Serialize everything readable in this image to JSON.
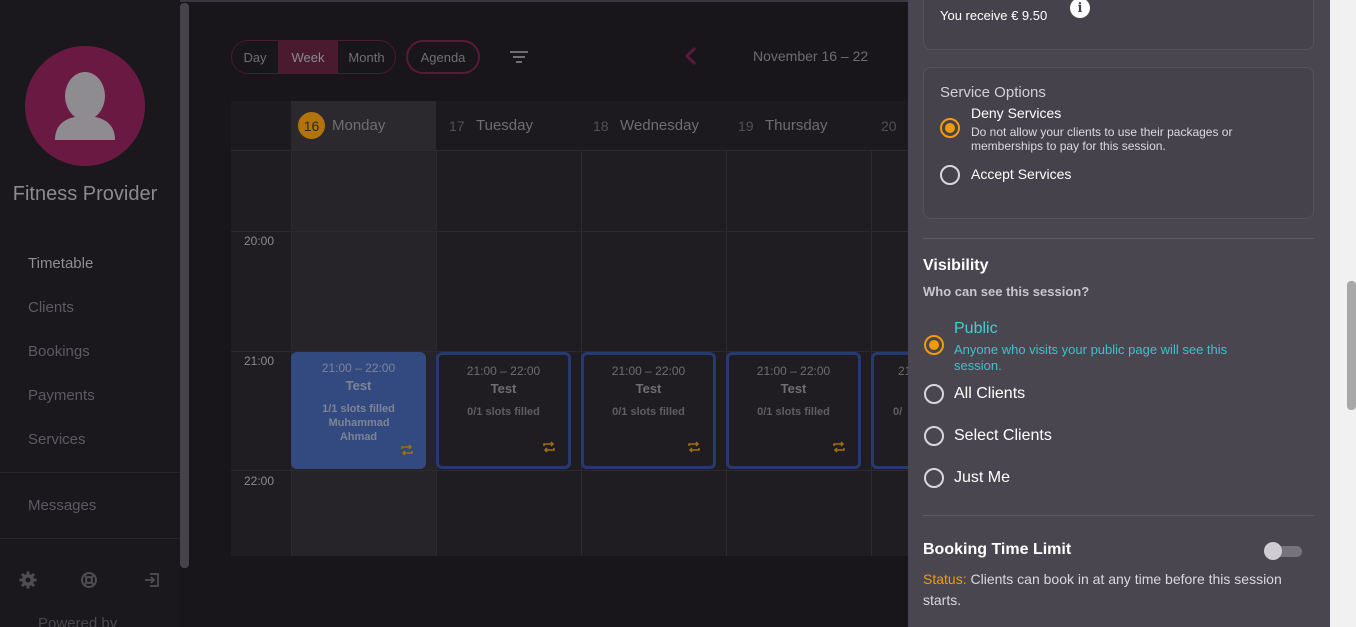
{
  "sidebar": {
    "profile_name": "Fitness Provider",
    "nav": [
      "Timetable",
      "Clients",
      "Bookings",
      "Payments",
      "Services"
    ],
    "messages": "Messages",
    "bottom_icons": [
      "gear-icon",
      "support-icon",
      "logout-icon"
    ],
    "powered_by": "Powered by"
  },
  "toolbar": {
    "views": [
      "Day",
      "Week",
      "Month"
    ],
    "active_view": "Week",
    "agenda": "Agenda",
    "date_range": "November 16 – 22"
  },
  "calendar": {
    "days": [
      {
        "num": "16",
        "name": "Monday",
        "today": true
      },
      {
        "num": "17",
        "name": "Tuesday"
      },
      {
        "num": "18",
        "name": "Wednesday"
      },
      {
        "num": "19",
        "name": "Thursday"
      },
      {
        "num": "20",
        "name": ""
      }
    ],
    "times": [
      "20:00",
      "21:00",
      "22:00"
    ],
    "events": [
      {
        "time": "21:00 – 22:00",
        "title": "Test",
        "slots": "1/1 slots filled",
        "attendee": "Muhammad Ahmad",
        "filled": true
      },
      {
        "time": "21:00 – 22:00",
        "title": "Test",
        "slots": "0/1 slots filled",
        "attendee": "",
        "filled": false
      },
      {
        "time": "21:00 – 22:00",
        "title": "Test",
        "slots": "0/1 slots filled",
        "attendee": "",
        "filled": false
      },
      {
        "time": "21:00 – 22:00",
        "title": "Test",
        "slots": "0/1 slots filled",
        "attendee": "",
        "filled": false
      },
      {
        "time": "21",
        "title": "",
        "slots": "0/",
        "attendee": "",
        "filled": false
      }
    ]
  },
  "panel": {
    "receive_text": "You receive € 9.50",
    "service_options": {
      "title": "Service Options",
      "options": [
        {
          "label": "Deny Services",
          "desc": "Do not allow your clients to use their packages or memberships to pay for this session.",
          "selected": true
        },
        {
          "label": "Accept Services",
          "desc": "",
          "selected": false
        }
      ]
    },
    "visibility": {
      "title": "Visibility",
      "subtitle": "Who can see this session?",
      "options": [
        {
          "label": "Public",
          "desc": "Anyone who visits your public page will see this session.",
          "selected": true
        },
        {
          "label": "All Clients",
          "selected": false
        },
        {
          "label": "Select Clients",
          "selected": false
        },
        {
          "label": "Just Me",
          "selected": false
        }
      ]
    },
    "booking_limit": {
      "title": "Booking Time Limit",
      "enabled": false,
      "status_key": "Status:",
      "status_text": " Clients can book in at any time before this session starts."
    }
  },
  "colors": {
    "accent_orange": "#f29a0c",
    "brand_magenta": "#6a1a42",
    "public_teal": "#3fd0d6"
  }
}
